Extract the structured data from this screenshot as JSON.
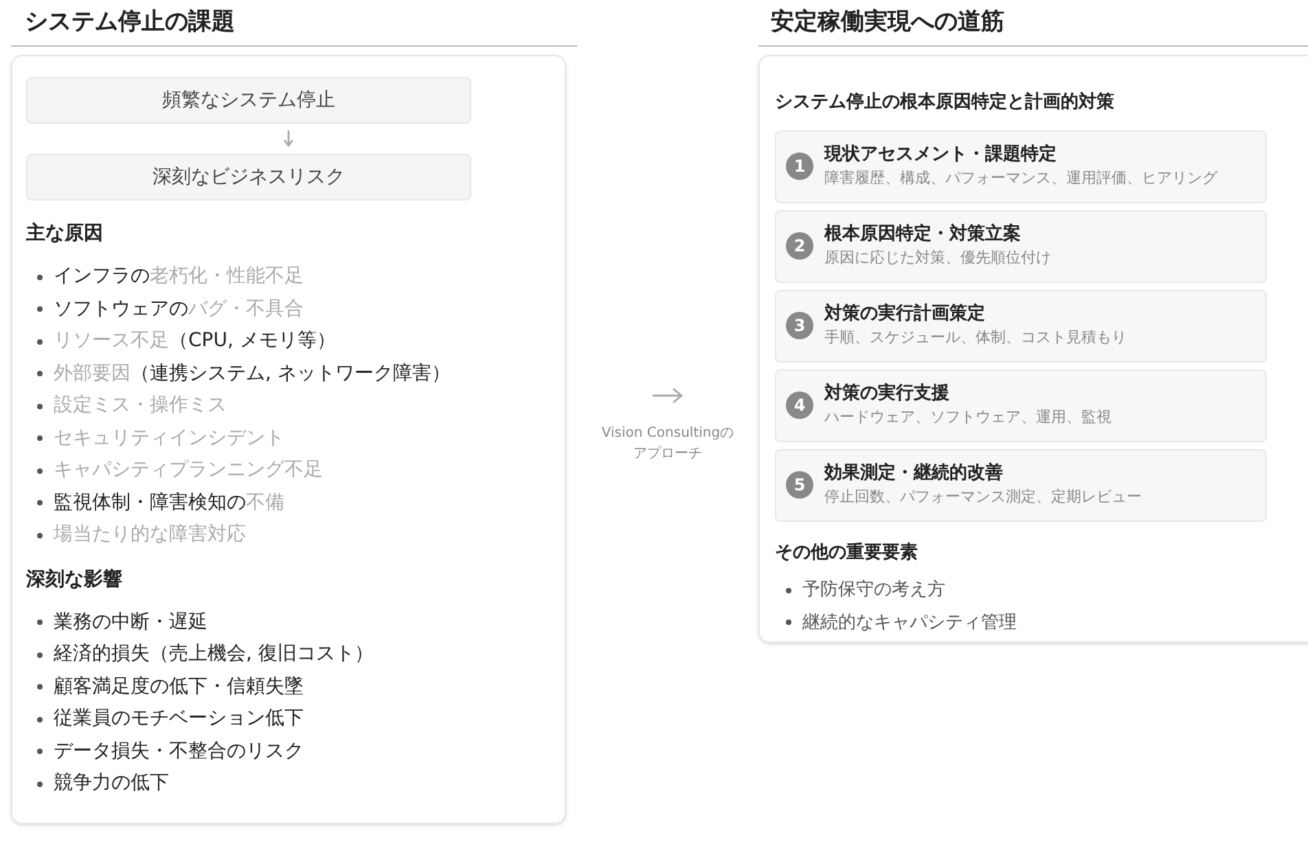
{
  "left": {
    "title": "システム停止の課題",
    "flow": [
      {
        "label": "頻繁なシステム停止"
      },
      {
        "label": "深刻なビジネスリスク"
      }
    ],
    "sections": [
      {
        "heading": "主な原因",
        "items": [
          {
            "parts": [
              {
                "text": "インフラの",
                "faded": false
              },
              {
                "text": "老朽化・性能不足",
                "faded": true
              }
            ]
          },
          {
            "parts": [
              {
                "text": "ソフトウェアの",
                "faded": false
              },
              {
                "text": "バグ・不具合",
                "faded": true
              }
            ]
          },
          {
            "parts": [
              {
                "text": "リソース不足",
                "faded": true
              },
              {
                "text": "（CPU, メモリ等）",
                "faded": false
              }
            ]
          },
          {
            "parts": [
              {
                "text": "外部要因",
                "faded": true
              },
              {
                "text": "（連携システム, ネットワーク障害）",
                "faded": false
              }
            ]
          },
          {
            "parts": [
              {
                "text": "設定ミス・操作ミス",
                "faded": true
              }
            ]
          },
          {
            "parts": [
              {
                "text": "セキュリティインシデント",
                "faded": true
              }
            ]
          },
          {
            "parts": [
              {
                "text": "キャパシティプランニング不足",
                "faded": true
              }
            ]
          },
          {
            "parts": [
              {
                "text": "監視体制・障害検知の",
                "faded": false
              },
              {
                "text": "不備",
                "faded": true
              }
            ]
          },
          {
            "parts": [
              {
                "text": "場当たり的な障害対応",
                "faded": true
              }
            ]
          }
        ]
      },
      {
        "heading": "深刻な影響",
        "items": [
          {
            "parts": [
              {
                "text": "業務の中断・遅延",
                "faded": false
              }
            ]
          },
          {
            "parts": [
              {
                "text": "経済的損失（売上機会, 復旧コスト）",
                "faded": false
              }
            ]
          },
          {
            "parts": [
              {
                "text": "顧客満足度の低下・信頼失墜",
                "faded": false
              }
            ]
          },
          {
            "parts": [
              {
                "text": "従業員のモチベーション低下",
                "faded": false
              }
            ]
          },
          {
            "parts": [
              {
                "text": "データ損失・不整合のリスク",
                "faded": false
              }
            ]
          },
          {
            "parts": [
              {
                "text": "競争力の低下",
                "faded": false
              }
            ]
          }
        ]
      }
    ]
  },
  "middle": {
    "caption_lines": [
      "Vision Consultingの",
      "アプローチ"
    ]
  },
  "right": {
    "title": "安定稼働実現への道筋",
    "subtitle": "システム停止の根本原因特定と計画的対策",
    "steps": [
      {
        "number": "1",
        "title": "現状アセスメント・課題特定",
        "detail": "障害履歴、構成、パフォーマンス、運用評価、ヒアリング"
      },
      {
        "number": "2",
        "title": "根本原因特定・対策立案",
        "detail": "原因に応じた対策、優先順位付け"
      },
      {
        "number": "3",
        "title": "対策の実行計画策定",
        "detail": "手順、スケジュール、体制、コスト見積もり"
      },
      {
        "number": "4",
        "title": "対策の実行支援",
        "detail": "ハードウェア、ソフトウェア、運用、監視"
      },
      {
        "number": "5",
        "title": "効果測定・継続的改善",
        "detail": "停止回数、パフォーマンス測定、定期レビュー"
      }
    ],
    "other_heading": "その他の重要要素",
    "other_items": [
      "予防保守の考え方",
      "継続的なキャパシティ管理"
    ]
  }
}
